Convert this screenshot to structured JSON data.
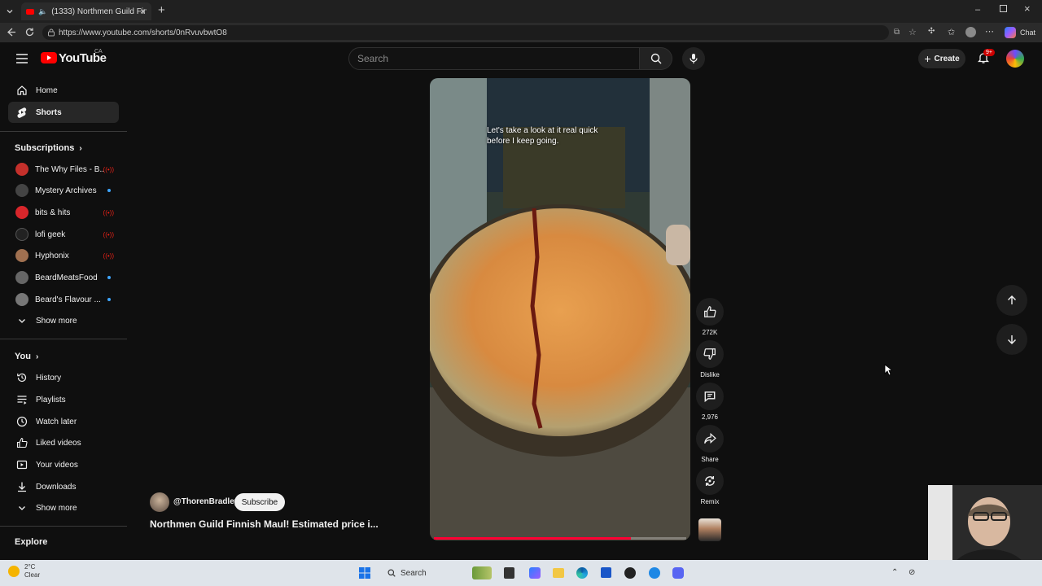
{
  "browser": {
    "tab_title": "(1333) Northmen Guild Finnis",
    "url": "https://www.youtube.com/shorts/0nRvuvbwtO8",
    "chat_label": "Chat"
  },
  "header": {
    "logo": "YouTube",
    "country": "CA",
    "search_placeholder": "Search",
    "create_label": "Create",
    "notification_badge": "9+"
  },
  "sidebar": {
    "main": [
      {
        "label": "Home",
        "icon": "home-icon"
      },
      {
        "label": "Shorts",
        "icon": "shorts-icon"
      }
    ],
    "subscriptions_title": "Subscriptions",
    "subscriptions": [
      {
        "name": "The Why Files - B...",
        "status": "live",
        "color": "#c4302b"
      },
      {
        "name": "Mystery Archives",
        "status": "new",
        "color": "#444444"
      },
      {
        "name": "bits & hits",
        "status": "live",
        "color": "#d8262b"
      },
      {
        "name": "lofi geek",
        "status": "live",
        "color": "#222222"
      },
      {
        "name": "Hyphonix",
        "status": "live",
        "color": "#a07050"
      },
      {
        "name": "BeardMeatsFood",
        "status": "new",
        "color": "#666666"
      },
      {
        "name": "Beard's Flavour ...",
        "status": "new",
        "color": "#777777"
      }
    ],
    "show_more_1": "Show more",
    "you_title": "You",
    "you_items": [
      {
        "label": "History",
        "icon": "history-icon"
      },
      {
        "label": "Playlists",
        "icon": "playlists-icon"
      },
      {
        "label": "Watch later",
        "icon": "watch-later-icon"
      },
      {
        "label": "Liked videos",
        "icon": "liked-videos-icon"
      },
      {
        "label": "Your videos",
        "icon": "your-videos-icon"
      },
      {
        "label": "Downloads",
        "icon": "downloads-icon"
      }
    ],
    "show_more_2": "Show more",
    "explore_title": "Explore"
  },
  "short": {
    "caption": "Let's take a look at it real quick before I keep going.",
    "channel": "@ThorenBradley",
    "subscribe_label": "Subscribe",
    "title": "Northmen Guild Finnish Maul! Estimated price i...",
    "progress": 0.78,
    "actions": {
      "likes": "272K",
      "dislike": "Dislike",
      "comments": "2,976",
      "share": "Share",
      "remix": "Remix"
    }
  },
  "taskbar": {
    "search_label": "Search",
    "weather_temp": "2°C",
    "weather_desc": "Clear"
  }
}
